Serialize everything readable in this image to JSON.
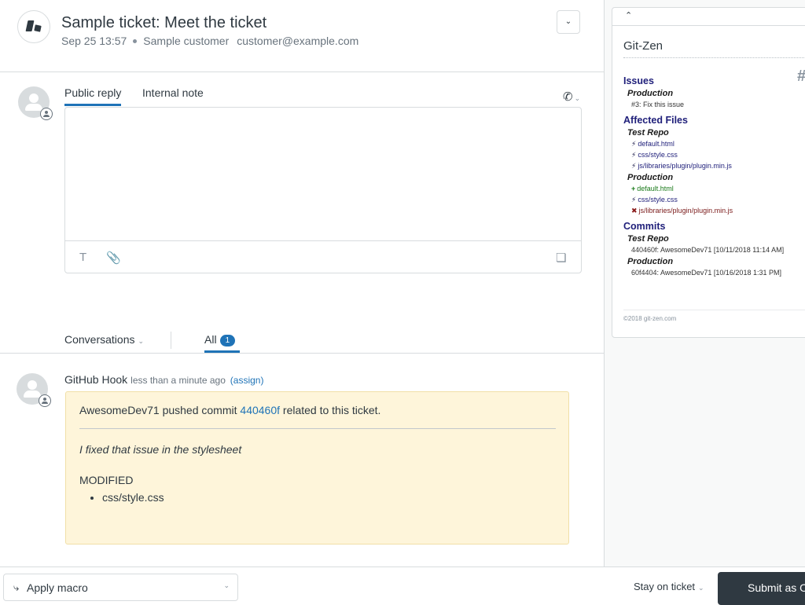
{
  "header": {
    "title": "Sample ticket: Meet the ticket",
    "date": "Sep 25 13:57",
    "customer": "Sample customer",
    "email": "customer@example.com",
    "menu_icon": "chevron-down-icon"
  },
  "composer": {
    "tabs": [
      {
        "label": "Public reply",
        "active": true
      },
      {
        "label": "Internal note",
        "active": false
      }
    ],
    "call_icon": "phone-outgoing-icon",
    "body_value": "",
    "toolbar": {
      "format_icon": "T",
      "attach_icon": "paperclip-icon",
      "apps_icon": "puzzle-icon"
    }
  },
  "conversations": {
    "filter_label": "Conversations",
    "all_label": "All",
    "all_count": "1"
  },
  "event": {
    "author": "GitHub Hook",
    "time": "less than a minute ago",
    "assign_label": "(assign)",
    "pusher": "AwesomeDev71",
    "pushed_text": "pushed commit",
    "commit": "440460f",
    "related_text": "related to this ticket.",
    "message": "I fixed that issue in the stylesheet",
    "modified_label": "MODIFIED",
    "files": [
      "css/style.css"
    ]
  },
  "footer": {
    "macro_label": "Apply macro",
    "stay_label": "Stay on ticket",
    "submit_label": "Submit as O"
  },
  "gitzen": {
    "title": "Git-Zen",
    "issues_heading": "Issues",
    "issues": [
      {
        "repo": "Production",
        "items": [
          "#3: Fix this issue"
        ]
      }
    ],
    "files_heading": "Affected Files",
    "files": [
      {
        "repo": "Test Repo",
        "items": [
          {
            "status": "modified",
            "icon": "⚡",
            "path": "default.html"
          },
          {
            "status": "modified",
            "icon": "⚡",
            "path": "css/style.css"
          },
          {
            "status": "modified",
            "icon": "⚡",
            "path": "js/libraries/plugin/plugin.min.js"
          }
        ]
      },
      {
        "repo": "Production",
        "items": [
          {
            "status": "added",
            "icon": "+",
            "path": "default.html"
          },
          {
            "status": "modified",
            "icon": "⚡",
            "path": "css/style.css"
          },
          {
            "status": "removed",
            "icon": "✖",
            "path": "js/libraries/plugin/plugin.min.js"
          }
        ]
      }
    ],
    "commits_heading": "Commits",
    "commits": [
      {
        "repo": "Test Repo",
        "items": [
          "440460f: AwesomeDev71 [10/11/2018 11:14 AM]"
        ]
      },
      {
        "repo": "Production",
        "items": [
          "60f4404: AwesomeDev71 [10/16/2018 1:31 PM]"
        ]
      }
    ],
    "footer": "©2018 git-zen.com"
  }
}
